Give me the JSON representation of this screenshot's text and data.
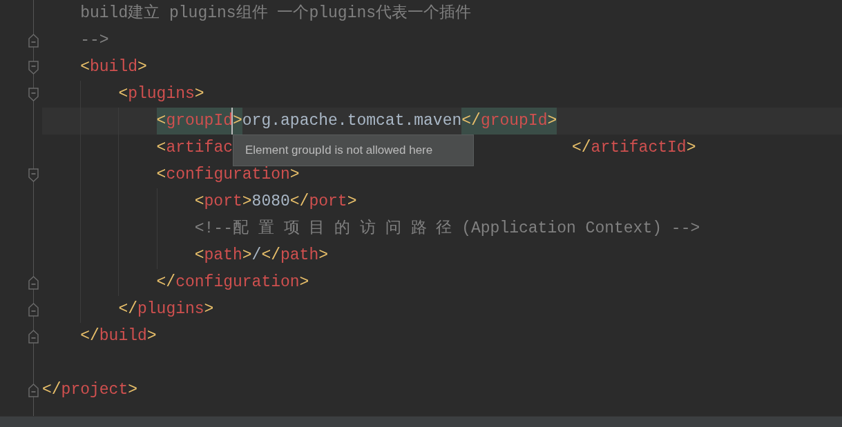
{
  "editor": {
    "lines": [
      {
        "children": [
          {
            "tokens": [
              {
                "kind": "comment",
                "text": "build建立 plugins组件 一个plugins代表一个插件"
              }
            ]
          },
          {
            "fold_end": true,
            "tokens": [
              {
                "kind": "comment",
                "text": "-->"
              }
            ]
          },
          {
            "fold_start": true,
            "tokens": [
              {
                "kind": "bracket",
                "text": "<"
              },
              {
                "kind": "tag",
                "text": "build"
              },
              {
                "kind": "bracket",
                "text": ">"
              }
            ],
            "children": [
              {
                "fold_start": true,
                "tokens": [
                  {
                    "kind": "bracket",
                    "text": "<"
                  },
                  {
                    "kind": "tag",
                    "text": "plugins"
                  },
                  {
                    "kind": "bracket",
                    "text": ">"
                  }
                ],
                "children": [
                  {
                    "current": true,
                    "tokens": [
                      {
                        "kind": "bracket",
                        "text": "<",
                        "highlighted": true
                      },
                      {
                        "kind": "tag",
                        "text": "groupId",
                        "highlighted": true,
                        "caret": true
                      },
                      {
                        "kind": "bracket",
                        "text": ">",
                        "highlighted": true
                      },
                      {
                        "kind": "text",
                        "text": "org.apache.tomcat.maven"
                      },
                      {
                        "kind": "bracket",
                        "text": "</",
                        "highlighted": true
                      },
                      {
                        "kind": "tag",
                        "text": "groupId",
                        "highlighted": true
                      },
                      {
                        "kind": "bracket",
                        "text": ">",
                        "highlighted": true
                      }
                    ]
                  },
                  {
                    "tokens": [
                      {
                        "kind": "bracket",
                        "text": "<"
                      },
                      {
                        "kind": "tag",
                        "text": "artifac"
                      },
                      {
                        "kind": "bracket",
                        "text": "</",
                        "covered_before": true
                      },
                      {
                        "kind": "tag",
                        "text": "artifactId"
                      },
                      {
                        "kind": "bracket",
                        "text": ">"
                      }
                    ]
                  },
                  {
                    "fold_start": true,
                    "tokens": [
                      {
                        "kind": "bracket",
                        "text": "<"
                      },
                      {
                        "kind": "tag",
                        "text": "configuration"
                      },
                      {
                        "kind": "bracket",
                        "text": ">"
                      }
                    ],
                    "children": [
                      {
                        "tokens": [
                          {
                            "kind": "bracket",
                            "text": "<"
                          },
                          {
                            "kind": "tag",
                            "text": "port"
                          },
                          {
                            "kind": "bracket",
                            "text": ">"
                          },
                          {
                            "kind": "text",
                            "text": "8080"
                          },
                          {
                            "kind": "bracket",
                            "text": "</"
                          },
                          {
                            "kind": "tag",
                            "text": "port"
                          },
                          {
                            "kind": "bracket",
                            "text": ">"
                          }
                        ]
                      },
                      {
                        "tokens": [
                          {
                            "kind": "comment",
                            "text": "<!--配 置 项 目 的 访 问 路 径 (Application Context) -->"
                          }
                        ]
                      },
                      {
                        "tokens": [
                          {
                            "kind": "bracket",
                            "text": "<"
                          },
                          {
                            "kind": "tag",
                            "text": "path"
                          },
                          {
                            "kind": "bracket",
                            "text": ">"
                          },
                          {
                            "kind": "text",
                            "text": "/"
                          },
                          {
                            "kind": "bracket",
                            "text": "</"
                          },
                          {
                            "kind": "tag",
                            "text": "path"
                          },
                          {
                            "kind": "bracket",
                            "text": ">"
                          }
                        ]
                      }
                    ]
                  },
                  {
                    "fold_end": true,
                    "tokens": [
                      {
                        "kind": "bracket",
                        "text": "</"
                      },
                      {
                        "kind": "tag",
                        "text": "configuration"
                      },
                      {
                        "kind": "bracket",
                        "text": ">"
                      }
                    ]
                  }
                ]
              },
              {
                "fold_end": true,
                "tokens": [
                  {
                    "kind": "bracket",
                    "text": "</"
                  },
                  {
                    "kind": "tag",
                    "text": "plugins"
                  },
                  {
                    "kind": "bracket",
                    "text": ">"
                  }
                ]
              }
            ]
          },
          {
            "fold_end": true,
            "tokens": [
              {
                "kind": "bracket",
                "text": "</"
              },
              {
                "kind": "tag",
                "text": "build"
              },
              {
                "kind": "bracket",
                "text": ">"
              }
            ]
          }
        ]
      },
      {
        "fold_end": true,
        "tokens": [
          {
            "kind": "bracket",
            "text": "</"
          },
          {
            "kind": "tag",
            "text": "project"
          },
          {
            "kind": "bracket",
            "text": ">"
          }
        ]
      }
    ]
  },
  "tooltip": {
    "text": "Element groupId is not allowed here"
  }
}
